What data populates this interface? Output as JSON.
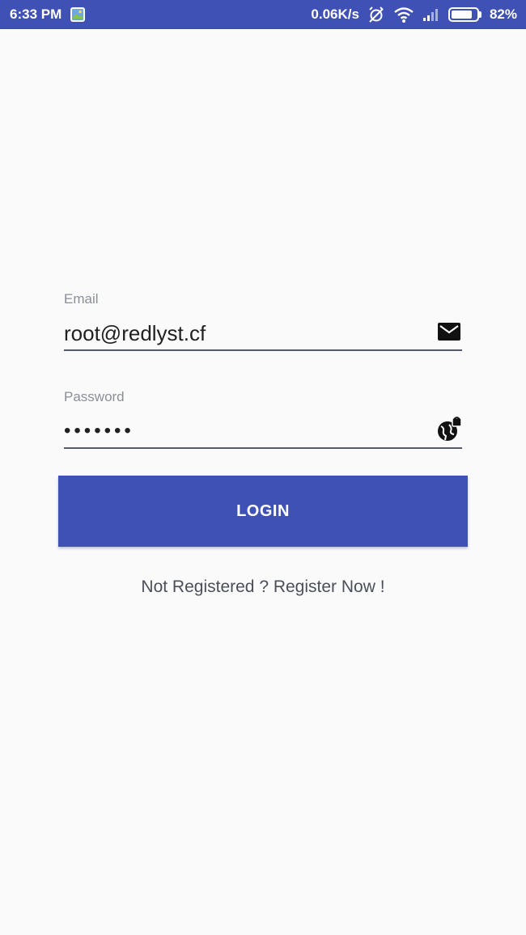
{
  "status_bar": {
    "time": "6:33 PM",
    "network_speed": "0.06K/s",
    "battery_percent": "82%",
    "battery_level": 0.82,
    "icons": [
      "gallery-icon",
      "alarm-off-icon",
      "wifi-icon",
      "signal-icon",
      "battery-icon"
    ]
  },
  "form": {
    "email_label": "Email",
    "email_value": "root@redlyst.cf",
    "email_icon": "mail-icon",
    "password_label": "Password",
    "password_value": "•••••••",
    "password_icon": "vpn-lock-icon"
  },
  "login_label": "LOGIN",
  "register_text": "Not Registered ? Register Now !",
  "colors": {
    "primary": "#3f51b5",
    "background": "#fafafa",
    "label": "#8a8f99",
    "text": "#212121"
  }
}
